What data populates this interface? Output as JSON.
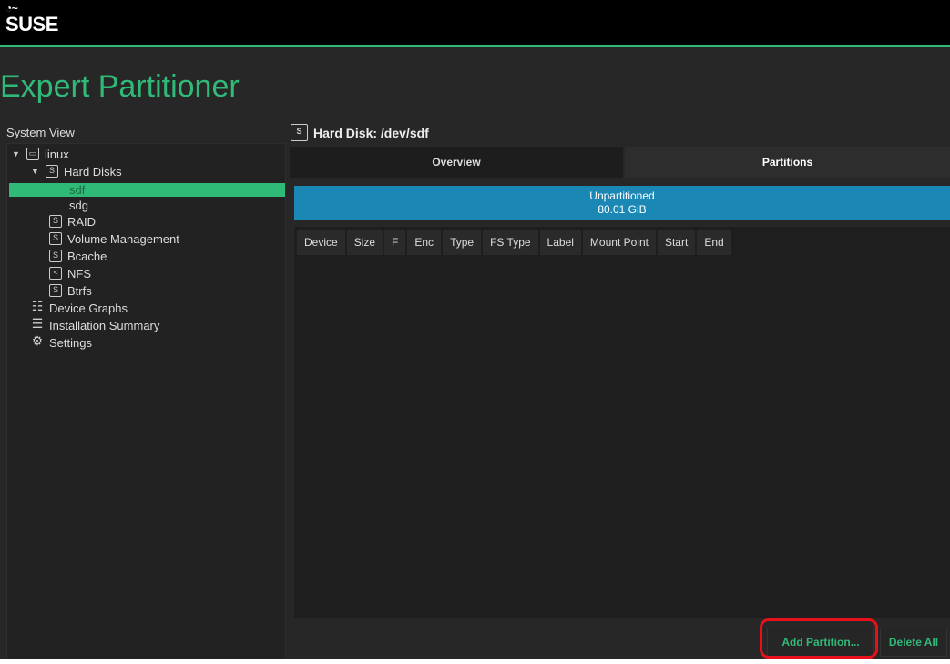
{
  "header": {
    "logo": "SUSE"
  },
  "title": "Expert Partitioner",
  "system_view": {
    "label": "System View",
    "items": [
      {
        "label": "linux",
        "icon": "computer-icon"
      },
      {
        "label": "Hard Disks",
        "icon": "disk-icon"
      },
      {
        "label": "sdf",
        "selected": true
      },
      {
        "label": "sdg"
      },
      {
        "label": "RAID",
        "icon": "raid-icon"
      },
      {
        "label": "Volume Management",
        "icon": "volume-icon"
      },
      {
        "label": "Bcache",
        "icon": "bcache-icon"
      },
      {
        "label": "NFS",
        "icon": "nfs-icon"
      },
      {
        "label": "Btrfs",
        "icon": "btrfs-icon"
      },
      {
        "label": "Device Graphs",
        "icon": "list-icon"
      },
      {
        "label": "Installation Summary",
        "icon": "list-icon"
      },
      {
        "label": "Settings",
        "icon": "gear-icon"
      }
    ]
  },
  "disk": {
    "title": "Hard Disk: /dev/sdf",
    "tabs": [
      "Overview",
      "Partitions"
    ],
    "active_tab": "Partitions",
    "bar": {
      "label": "Unpartitioned",
      "size": "80.01 GiB",
      "color": "#1a87b5"
    }
  },
  "table": {
    "columns": [
      "Device",
      "Size",
      "F",
      "Enc",
      "Type",
      "FS Type",
      "Label",
      "Mount Point",
      "Start",
      "End"
    ],
    "rows": []
  },
  "buttons": {
    "add": "Add Partition...",
    "delete": "Delete All"
  },
  "colors": {
    "accent": "#30ba78",
    "highlight": "#e8101a"
  }
}
